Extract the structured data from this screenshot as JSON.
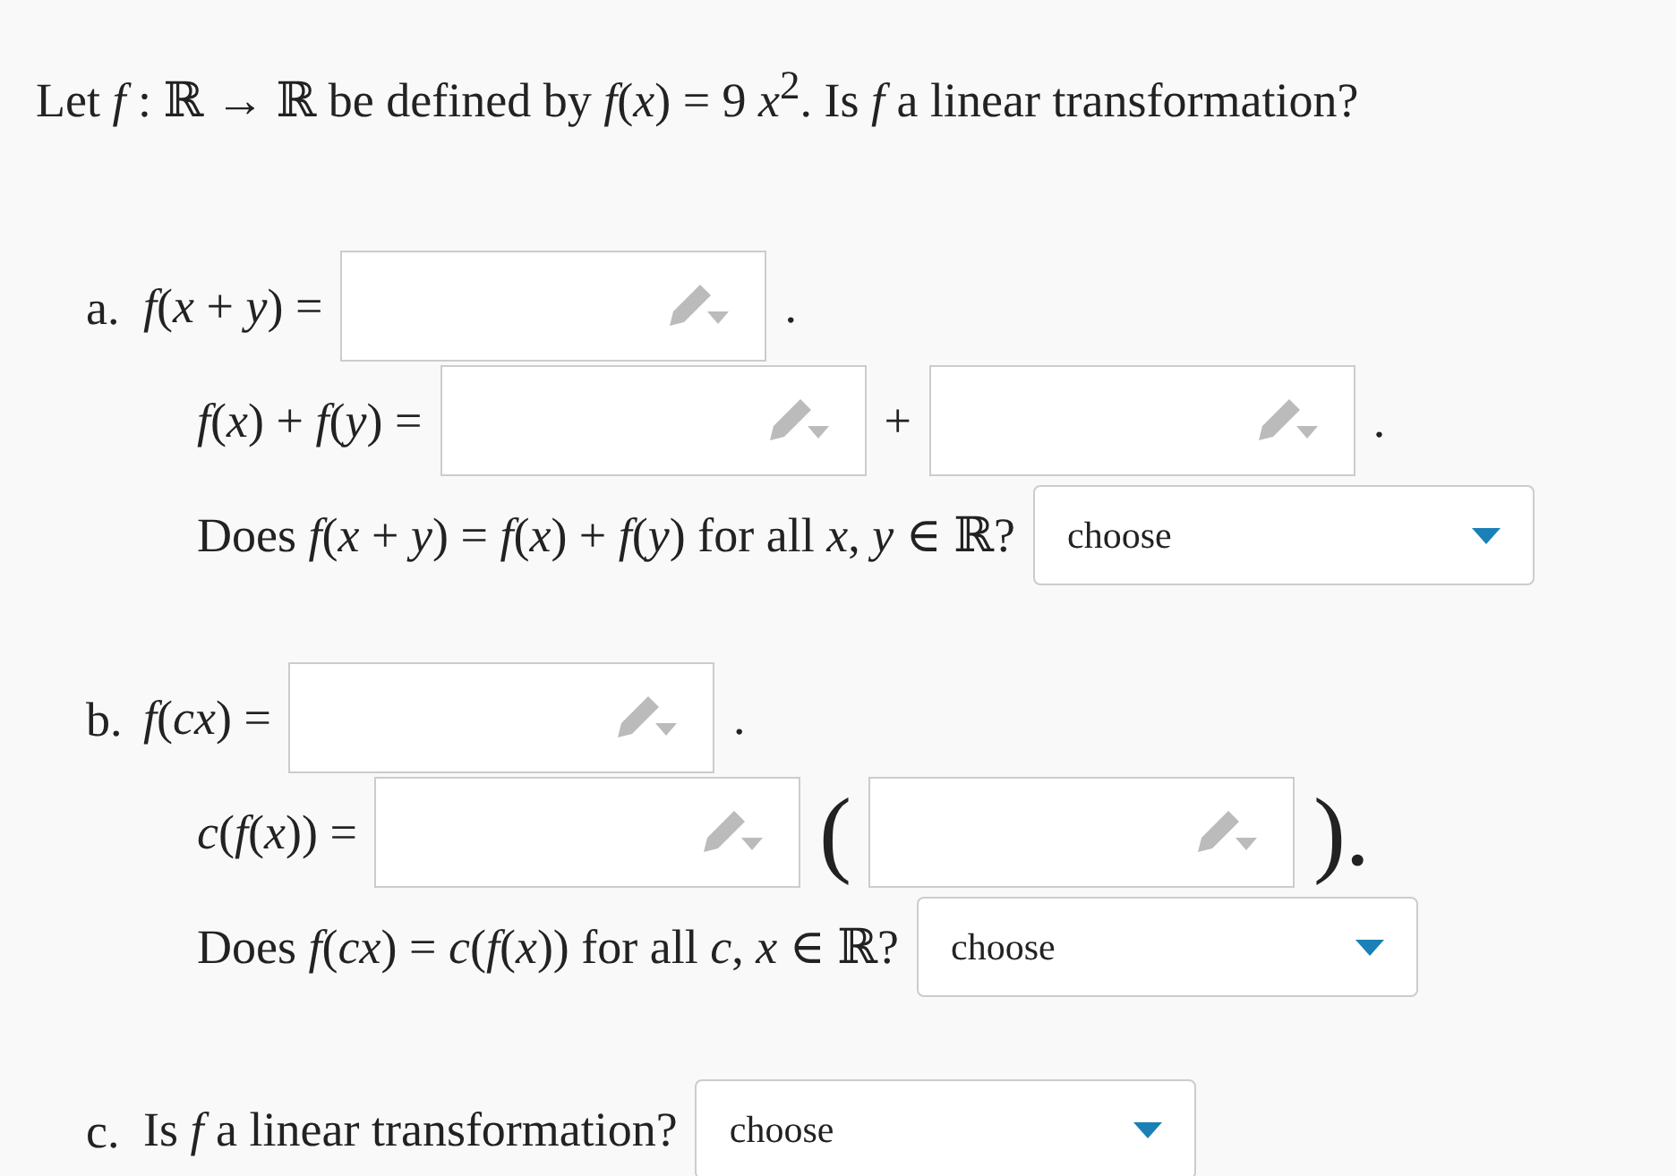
{
  "question": "Let *f* : ℝ → ℝ be defined by *f*(*x*) = 9 *x*$^{2}$. Is *f* a linear transformation?",
  "parts": [
    {
      "label": "a.",
      "rows": [
        [
          {
            "kind": "math",
            "text": "*f*(*x* + *y*) ="
          },
          {
            "kind": "input"
          },
          {
            "kind": "math",
            "text": "."
          }
        ],
        [
          {
            "kind": "math",
            "text": "*f*(*x*) + *f*(*y*) ="
          },
          {
            "kind": "input"
          },
          {
            "kind": "math",
            "text": "+"
          },
          {
            "kind": "input"
          },
          {
            "kind": "math",
            "text": "."
          }
        ],
        [
          {
            "kind": "math",
            "text": "Does *f*(*x* + *y*) = *f*(*x*) + *f*(*y*) for all *x*, *y* ∈ ℝ?"
          },
          {
            "kind": "select",
            "value": "choose"
          }
        ]
      ]
    },
    {
      "label": "b.",
      "rows": [
        [
          {
            "kind": "math",
            "text": "*f*(*cx*) ="
          },
          {
            "kind": "input"
          },
          {
            "kind": "math",
            "text": "."
          }
        ],
        [
          {
            "kind": "math",
            "text": "*c*(*f*(*x*)) ="
          },
          {
            "kind": "input"
          },
          {
            "kind": "big",
            "text": "("
          },
          {
            "kind": "input"
          },
          {
            "kind": "big",
            "text": ")."
          }
        ],
        [
          {
            "kind": "math",
            "text": "Does *f*(*cx*) = *c*(*f*(*x*)) for all *c*, *x* ∈ ℝ?"
          },
          {
            "kind": "select",
            "value": "choose"
          }
        ]
      ]
    },
    {
      "label": "c.",
      "rows": [
        [
          {
            "kind": "math",
            "text": "Is *f* a linear transformation?"
          },
          {
            "kind": "select",
            "value": "choose"
          }
        ]
      ]
    }
  ]
}
